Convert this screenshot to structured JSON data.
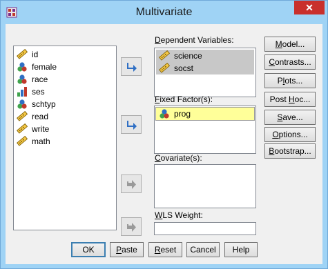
{
  "window": {
    "title": "Multivariate",
    "close_glyph": "✕"
  },
  "source_list": [
    {
      "name": "id",
      "icon": "scale-ruler-icon"
    },
    {
      "name": "female",
      "icon": "nominal-icon"
    },
    {
      "name": "race",
      "icon": "nominal-icon"
    },
    {
      "name": "ses",
      "icon": "ordinal-icon"
    },
    {
      "name": "schtyp",
      "icon": "nominal-icon"
    },
    {
      "name": "read",
      "icon": "scale-ruler-icon"
    },
    {
      "name": "write",
      "icon": "scale-ruler-icon"
    },
    {
      "name": "math",
      "icon": "scale-ruler-icon"
    }
  ],
  "dependent": {
    "label_prefix": "D",
    "label_rest": "ependent Variables:",
    "items": [
      {
        "name": "science"
      },
      {
        "name": "socst"
      }
    ]
  },
  "fixed": {
    "label_prefix": "F",
    "label_rest": "ixed Factor(s):",
    "items": [
      {
        "name": "prog"
      }
    ]
  },
  "covariate": {
    "label_prefix": "C",
    "label_rest": "ovariate(s):"
  },
  "wls": {
    "label_prefix": "W",
    "label_rest": "LS Weight:",
    "value": ""
  },
  "right_buttons": [
    {
      "pre": "",
      "key": "M",
      "post": "odel..."
    },
    {
      "pre": "",
      "key": "C",
      "post": "ontrasts..."
    },
    {
      "pre": "P",
      "key": "l",
      "post": "ots..."
    },
    {
      "pre": "Post ",
      "key": "H",
      "post": "oc..."
    },
    {
      "pre": "",
      "key": "S",
      "post": "ave..."
    },
    {
      "pre": "",
      "key": "O",
      "post": "ptions..."
    },
    {
      "pre": "",
      "key": "B",
      "post": "ootstrap..."
    }
  ],
  "bottom_buttons": [
    {
      "pre": "OK",
      "key": "",
      "post": ""
    },
    {
      "pre": "",
      "key": "P",
      "post": "aste"
    },
    {
      "pre": "",
      "key": "R",
      "post": "eset"
    },
    {
      "pre": "Cancel",
      "key": "",
      "post": ""
    },
    {
      "pre": "Help",
      "key": "",
      "post": ""
    }
  ],
  "colors": {
    "titlebar": "#9fd3f5",
    "close": "#c9302c",
    "arrow_active": "#2f6fc4",
    "arrow_disabled": "#9a9a9a",
    "highlight": "#ffff99"
  }
}
